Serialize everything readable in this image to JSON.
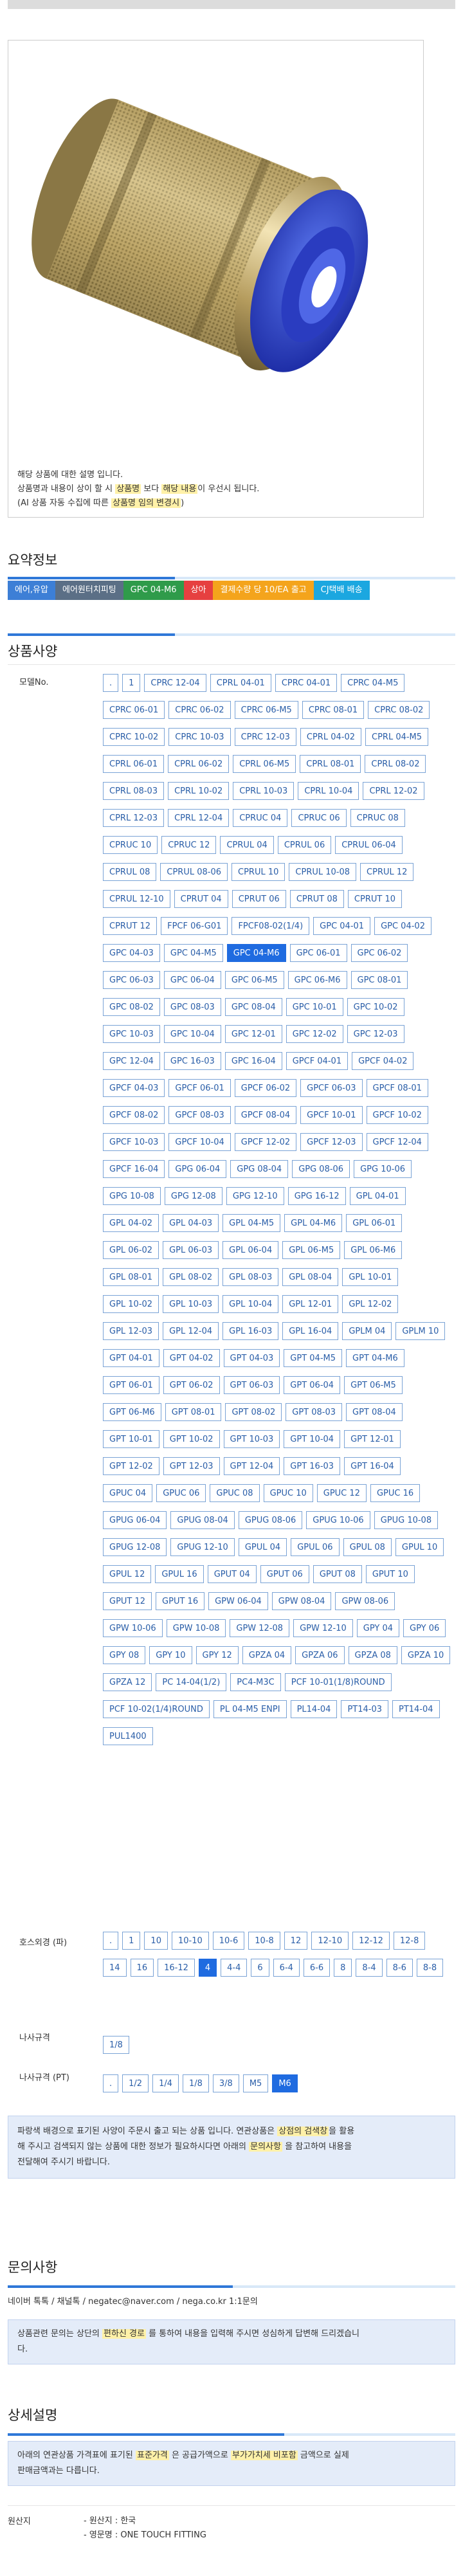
{
  "product": {
    "image_icon": "push-in-fitting-image",
    "description": [
      [
        {
          "t": "해당 상품에 대한 설명 입니다."
        }
      ],
      [
        {
          "t": "상품명과 내용이 상이 할 시 "
        },
        {
          "t": "상품명",
          "h": 1
        },
        {
          "t": " 보다 "
        },
        {
          "t": "해당 내용",
          "h": 1
        },
        {
          "t": "이 우선시 됩니다."
        }
      ],
      [
        {
          "t": "(AI 상품 자동 수집에 따른 "
        },
        {
          "t": "상품명 임의 변경시",
          "h": 1
        },
        {
          "t": ")"
        }
      ]
    ]
  },
  "summary": {
    "title": "요약정보",
    "tags": [
      {
        "label": "에어,유압",
        "color": "#3d7fd6"
      },
      {
        "label": "에어원터치피팅",
        "color": "#5b6f86"
      },
      {
        "label": "GPC 04-M6",
        "color": "#2f9b4a"
      },
      {
        "label": "상아",
        "color": "#e64040"
      },
      {
        "label": "결제수량 당 10/EA 출고",
        "color": "#f4a41c"
      },
      {
        "label": "CJ택배 배송",
        "color": "#1ba7e0"
      }
    ]
  },
  "options": {
    "title": "상품사양",
    "model": {
      "label": "모델No.",
      "selected": "GPC 04-M6",
      "values": [
        ".",
        "1",
        "CPRC 12-04",
        "CPRL 04-01",
        "CPRC 04-01",
        "CPRC 04-M5",
        "CPRC 06-01",
        "CPRC 06-02",
        "CPRC 06-M5",
        "CPRC 08-01",
        "CPRC 08-02",
        "CPRC 10-02",
        "CPRC 10-03",
        "CPRC 12-03",
        "CPRL 04-02",
        "CPRL 04-M5",
        "CPRL 06-01",
        "CPRL 06-02",
        "CPRL 06-M5",
        "CPRL 08-01",
        "CPRL 08-02",
        "CPRL 08-03",
        "CPRL 10-02",
        "CPRL 10-03",
        "CPRL 10-04",
        "CPRL 12-02",
        "CPRL 12-03",
        "CPRL 12-04",
        "CPRUC 04",
        "CPRUC 06",
        "CPRUC 08",
        "CPRUC 10",
        "CPRUC 12",
        "CPRUL 04",
        "CPRUL 06",
        "CPRUL 06-04",
        "CPRUL 08",
        "CPRUL 08-06",
        "CPRUL 10",
        "CPRUL 10-08",
        "CPRUL 12",
        "CPRUL 12-10",
        "CPRUT 04",
        "CPRUT 06",
        "CPRUT 08",
        "CPRUT 10",
        "CPRUT 12",
        "FPCF 06-G01",
        "FPCF08-02(1/4)",
        "GPC 04-01",
        "GPC 04-02",
        "GPC 04-03",
        "GPC 04-M5",
        "GPC 04-M6",
        "GPC 06-01",
        "GPC 06-02",
        "GPC 06-03",
        "GPC 06-04",
        "GPC 06-M5",
        "GPC 06-M6",
        "GPC 08-01",
        "GPC 08-02",
        "GPC 08-03",
        "GPC 08-04",
        "GPC 10-01",
        "GPC 10-02",
        "GPC 10-03",
        "GPC 10-04",
        "GPC 12-01",
        "GPC 12-02",
        "GPC 12-03",
        "GPC 12-04",
        "GPC 16-03",
        "GPC 16-04",
        "GPCF 04-01",
        "GPCF 04-02",
        "GPCF 04-03",
        "GPCF 06-01",
        "GPCF 06-02",
        "GPCF 06-03",
        "GPCF 08-01",
        "GPCF 08-02",
        "GPCF 08-03",
        "GPCF 08-04",
        "GPCF 10-01",
        "GPCF 10-02",
        "GPCF 10-03",
        "GPCF 10-04",
        "GPCF 12-02",
        "GPCF 12-03",
        "GPCF 12-04",
        "GPCF 16-04",
        "GPG 06-04",
        "GPG 08-04",
        "GPG 08-06",
        "GPG 10-06",
        "GPG 10-08",
        "GPG 12-08",
        "GPG 12-10",
        "GPG 16-12",
        "GPL 04-01",
        "GPL 04-02",
        "GPL 04-03",
        "GPL 04-M5",
        "GPL 04-M6",
        "GPL 06-01",
        "GPL 06-02",
        "GPL 06-03",
        "GPL 06-04",
        "GPL 06-M5",
        "GPL 06-M6",
        "GPL 08-01",
        "GPL 08-02",
        "GPL 08-03",
        "GPL 08-04",
        "GPL 10-01",
        "GPL 10-02",
        "GPL 10-03",
        "GPL 10-04",
        "GPL 12-01",
        "GPL 12-02",
        "GPL 12-03",
        "GPL 12-04",
        "GPL 16-03",
        "GPL 16-04",
        "GPLM 04",
        "GPLM 10",
        "GPT 04-01",
        "GPT 04-02",
        "GPT 04-03",
        "GPT 04-M5",
        "GPT 04-M6",
        "GPT 06-01",
        "GPT 06-02",
        "GPT 06-03",
        "GPT 06-04",
        "GPT 06-M5",
        "GPT 06-M6",
        "GPT 08-01",
        "GPT 08-02",
        "GPT 08-03",
        "GPT 08-04",
        "GPT 10-01",
        "GPT 10-02",
        "GPT 10-03",
        "GPT 10-04",
        "GPT 12-01",
        "GPT 12-02",
        "GPT 12-03",
        "GPT 12-04",
        "GPT 16-03",
        "GPT 16-04",
        "GPUC 04",
        "GPUC 06",
        "GPUC 08",
        "GPUC 10",
        "GPUC 12",
        "GPUC 16",
        "GPUG 06-04",
        "GPUG 08-04",
        "GPUG 08-06",
        "GPUG 10-06",
        "GPUG 10-08",
        "GPUG 12-08",
        "GPUG 12-10",
        "GPUL 04",
        "GPUL 06",
        "GPUL 08",
        "GPUL 10",
        "GPUL 12",
        "GPUL 16",
        "GPUT 04",
        "GPUT 06",
        "GPUT 08",
        "GPUT 10",
        "GPUT 12",
        "GPUT 16",
        "GPW 06-04",
        "GPW 08-04",
        "GPW 08-06",
        "GPW 10-06",
        "GPW 10-08",
        "GPW 12-08",
        "GPW 12-10",
        "GPY 04",
        "GPY 06",
        "GPY 08",
        "GPY 10",
        "GPY 12",
        "GPZA 04",
        "GPZA 06",
        "GPZA 08",
        "GPZA 10",
        "GPZA 12",
        "PC 14-04(1/2)",
        "PC4-M3C",
        "PCF 10-01(1/8)ROUND",
        "PCF 10-02(1/4)ROUND",
        "PL 04-M5 ENPI",
        "PL14-04",
        "PT14-03",
        "PT14-04",
        "PUL1400"
      ]
    },
    "hose": {
      "label": "호스외경 (파)",
      "selected": "4",
      "values": [
        ".",
        "1",
        "10",
        "10-10",
        "10-6",
        "10-8",
        "12",
        "12-10",
        "12-12",
        "12-8",
        "14",
        "16",
        "16-12",
        "4",
        "4-4",
        "6",
        "6-4",
        "6-6",
        "8",
        "8-4",
        "8-6",
        "8-8"
      ]
    },
    "inner": {
      "label": "나사규격",
      "selected": "",
      "values": [
        "1/8"
      ]
    },
    "pt": {
      "label": "나사규격 (PT)",
      "selected": "M6",
      "values": [
        ".",
        "1/2",
        "1/4",
        "1/8",
        "3/8",
        "M5",
        "M6"
      ]
    },
    "notice": [
      [
        {
          "t": "파랑색 배경으로 표기된 사양이 주문시 출고 되는 상품 입니다. 연관상품은 "
        },
        {
          "t": "상점의 검색창",
          "h": 1
        },
        {
          "t": "을 활용"
        }
      ],
      [
        {
          "t": "해 주시고 검색되지 않는 상품에 대한 정보가 필요하시다면 아래의 "
        },
        {
          "t": "문의사항",
          "h": 1
        },
        {
          "t": " 을 참고하여 내용을"
        }
      ],
      [
        {
          "t": "전달해여 주시기 바랍니다."
        }
      ]
    ]
  },
  "inquiry": {
    "title": "문의사항",
    "contact": "네이버 톡톡 / 채널톡 / negatec@naver.com / nega.co.kr 1:1문의",
    "notice": [
      [
        {
          "t": "상품관련 문의는 상단의 "
        },
        {
          "t": "편하신 경로",
          "h": 1
        },
        {
          "t": " 를 통하여 내용을 입력해 주시면 성심하게 답변해 드리겠습니"
        }
      ],
      [
        {
          "t": "다."
        }
      ]
    ]
  },
  "detail": {
    "title": "상세설명",
    "notice": [
      [
        {
          "t": "아래의 연관상품 가격표에 표기된 "
        },
        {
          "t": "표준가격",
          "h": 1
        },
        {
          "t": " 은 공급가액으로 "
        },
        {
          "t": "부가가치세 비포함",
          "h": 1
        },
        {
          "t": " 금액으로 실제"
        }
      ],
      [
        {
          "t": "판매금액과는 다릅니다."
        }
      ]
    ]
  },
  "origin": {
    "label": "원산지",
    "items": [
      "- 원산지 : 한국",
      "- 영문명 : ONE TOUCH FITTING"
    ]
  }
}
